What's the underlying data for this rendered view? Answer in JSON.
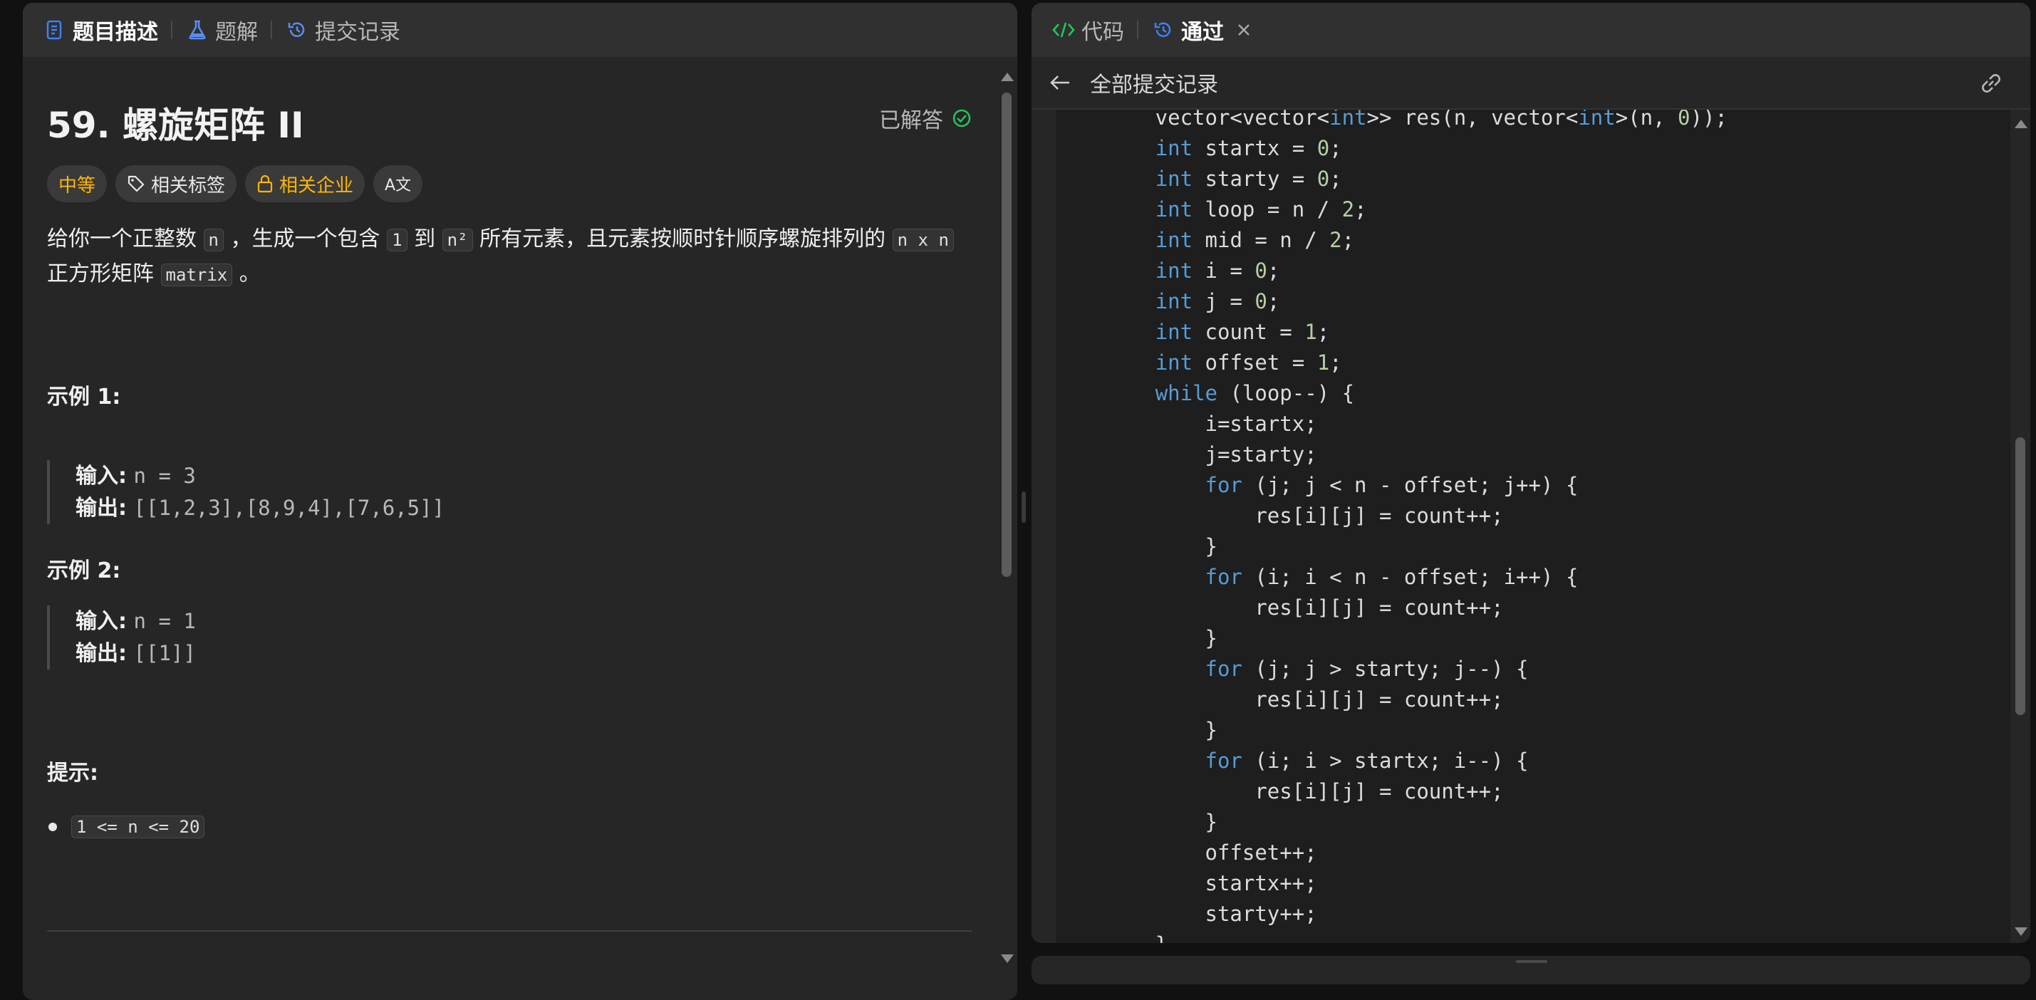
{
  "left_tabs": [
    {
      "label": "题目描述",
      "icon": "document-icon",
      "color": "#3b82f6"
    },
    {
      "label": "题解",
      "icon": "flask-icon",
      "color": "#5b8def"
    },
    {
      "label": "提交记录",
      "icon": "history-icon",
      "color": "#5b8def"
    }
  ],
  "problem": {
    "title": "59. 螺旋矩阵 II",
    "status": "已解答",
    "tags": {
      "difficulty": "中等",
      "related_tags": "相关标签",
      "related_companies": "相关企业",
      "translate": "A文"
    },
    "description": {
      "p1": "给你一个正整数",
      "c1": "n",
      "p2": "，生成一个包含",
      "c2": "1",
      "p3": "到",
      "c3": "n²",
      "p4": "所有元素，且元素按顺时针顺序螺旋排列的",
      "c4": "n x n",
      "p5": "正方形矩阵",
      "c5": "matrix",
      "p6": "。"
    },
    "example1": {
      "heading": "示例 1:",
      "input_label": "输入:",
      "input_value": "n = 3",
      "output_label": "输出:",
      "output_value": "[[1,2,3],[8,9,4],[7,6,5]]"
    },
    "example2": {
      "heading": "示例 2:",
      "input_label": "输入:",
      "input_value": "n = 1",
      "output_label": "输出:",
      "output_value": "[[1]]"
    },
    "hints_heading": "提示:",
    "hint": "1 <= n <= 20"
  },
  "right_tabs": [
    {
      "label": "代码",
      "icon": "code-icon",
      "color": "#22c55e"
    },
    {
      "label": "通过",
      "icon": "history-icon",
      "color": "#3b82f6"
    }
  ],
  "submissions_bar": {
    "back_label": "全部提交记录"
  },
  "code_lines": [
    "        vector<vector<int>> res(n, vector<int>(n, 0));",
    "        int startx = 0;",
    "        int starty = 0;",
    "        int loop = n / 2;",
    "        int mid = n / 2;",
    "        int i = 0;",
    "        int j = 0;",
    "        int count = 1;",
    "        int offset = 1;",
    "        while (loop--) {",
    "            i=startx;",
    "            j=starty;",
    "            for (j; j < n - offset; j++) {",
    "                res[i][j] = count++;",
    "            }",
    "            for (i; i < n - offset; i++) {",
    "                res[i][j] = count++;",
    "            }",
    "            for (j; j > starty; j--) {",
    "                res[i][j] = count++;",
    "            }",
    "            for (i; i > startx; i--) {",
    "                res[i][j] = count++;",
    "            }",
    "            offset++;",
    "            startx++;",
    "            starty++;",
    "        }"
  ],
  "colors": {
    "accent_blue": "#3b82f6",
    "difficulty_medium": "#ffb700",
    "success_green": "#22c55e",
    "keyword": "#569cd6",
    "number": "#b5cea8"
  }
}
